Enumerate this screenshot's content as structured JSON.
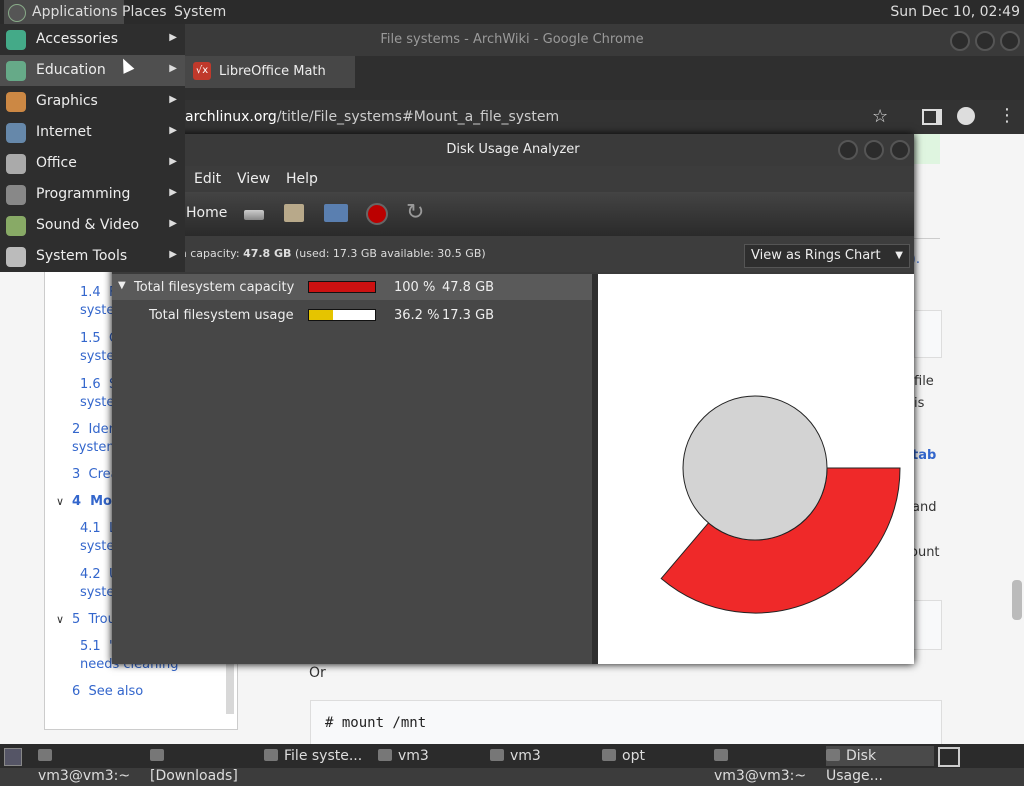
{
  "top_panel": {
    "menus": [
      "Applications",
      "Places",
      "System"
    ],
    "clock": "Sun Dec 10, 02:49"
  },
  "chrome": {
    "window_title": "File systems - ArchWiki - Google Chrome",
    "tab_label": "LibreOffice Math",
    "url_host": "archlinux.org",
    "url_path": "/title/File_systems#Mount_a_file_system"
  },
  "wiki": {
    "toc": [
      {
        "text": "1.4  F\nsyste",
        "indent": 1
      },
      {
        "text": "1.5  C\nsyste",
        "indent": 1
      },
      {
        "text": "1.6  S\nsyste",
        "indent": 1
      },
      {
        "text": "2  Iden\nsystem",
        "indent": 0
      },
      {
        "text": "3  Crea",
        "indent": 0
      },
      {
        "text": "4  Mou",
        "indent": 0,
        "bold": true,
        "arrow": "v"
      },
      {
        "text": "4.1  L\nsyste",
        "indent": 1
      },
      {
        "text": "4.2  U\nsyste",
        "indent": 1
      },
      {
        "text": "5  Trou",
        "indent": 0,
        "arrow": "v"
      },
      {
        "text": "5.1  \"\nneeds cleaning",
        "indent": 1
      },
      {
        "text": "6  See also",
        "indent": 0
      }
    ],
    "fragments": {
      "s_paren": "s).",
      "file": "file",
      "is": "is",
      "tab": "tab",
      "and": "and",
      "ount": "ount",
      "or": "Or"
    },
    "code": "# mount /mnt"
  },
  "dua": {
    "title": "Disk Usage Analyzer",
    "menus": [
      "Edit",
      "View",
      "Help"
    ],
    "home_label": "Home",
    "capacity_prefix": "m capacity: ",
    "capacity_total": "47.8 GB",
    "capacity_detail": " (used: 17.3 GB available: 30.5 GB)",
    "view_mode": "View as Rings Chart",
    "rows": [
      {
        "name": "Total filesystem capacity",
        "percent": "100 %",
        "size": "47.8 GB",
        "fill": 1.0,
        "color": "#cc1111"
      },
      {
        "name": "Total filesystem usage",
        "percent": "36.2 %",
        "size": "17.3 GB",
        "fill": 0.362,
        "color": "#e5c400"
      }
    ],
    "ring_colors": {
      "center": "#d3d3d3",
      "ring": "#ef2929"
    }
  },
  "app_menu": {
    "items": [
      {
        "label": "Accessories",
        "icon": "accessories-icon",
        "color": "#4a8"
      },
      {
        "label": "Education",
        "icon": "education-icon",
        "color": "#6a8",
        "active": true
      },
      {
        "label": "Graphics",
        "icon": "graphics-icon",
        "color": "#c84"
      },
      {
        "label": "Internet",
        "icon": "internet-icon",
        "color": "#68a"
      },
      {
        "label": "Office",
        "icon": "office-icon",
        "color": "#aaa"
      },
      {
        "label": "Programming",
        "icon": "programming-icon",
        "color": "#888"
      },
      {
        "label": "Sound & Video",
        "icon": "sound-video-icon",
        "color": "#8a6"
      },
      {
        "label": "System Tools",
        "icon": "system-tools-icon",
        "color": "#bbb"
      }
    ]
  },
  "taskbar": {
    "tasks": [
      {
        "label": "vm3@vm3:~",
        "icon": "terminal-icon"
      },
      {
        "label": "[Downloads]",
        "icon": "folder-icon"
      },
      {
        "label": "File syste...",
        "icon": "chrome-icon"
      },
      {
        "label": "vm3",
        "icon": "home-folder-icon"
      },
      {
        "label": "vm3",
        "icon": "home-folder-icon"
      },
      {
        "label": "opt",
        "icon": "folder-icon"
      },
      {
        "label": "vm3@vm3:~",
        "icon": "terminal-icon"
      },
      {
        "label": "Disk Usage...",
        "icon": "disk-usage-icon",
        "active": true
      }
    ]
  }
}
